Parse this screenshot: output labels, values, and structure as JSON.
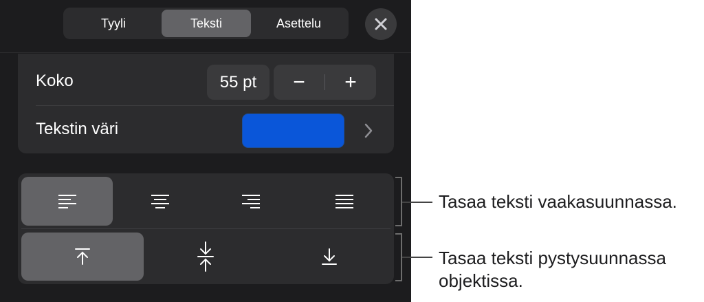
{
  "tabs": [
    {
      "label": "Tyyli",
      "active": false
    },
    {
      "label": "Teksti",
      "active": true
    },
    {
      "label": "Asettelu",
      "active": false
    }
  ],
  "size": {
    "label": "Koko",
    "value": "55 pt",
    "decrement": "−",
    "increment": "+"
  },
  "text_color": {
    "label": "Tekstin väri",
    "swatch": "#0a56d9"
  },
  "horizontal_align": {
    "selected": "left",
    "options": [
      "left",
      "center",
      "right",
      "justify"
    ]
  },
  "vertical_align": {
    "selected": "top",
    "options": [
      "top",
      "middle",
      "bottom"
    ]
  },
  "callouts": {
    "horizontal": "Tasaa teksti vaakasuunnassa.",
    "vertical_1": "Tasaa teksti pystysuunnassa",
    "vertical_2": "objektissa."
  },
  "colors": {
    "panel": "#1c1c1e",
    "group": "#2c2c2e",
    "active": "#636366",
    "accent": "#0a56d9"
  }
}
